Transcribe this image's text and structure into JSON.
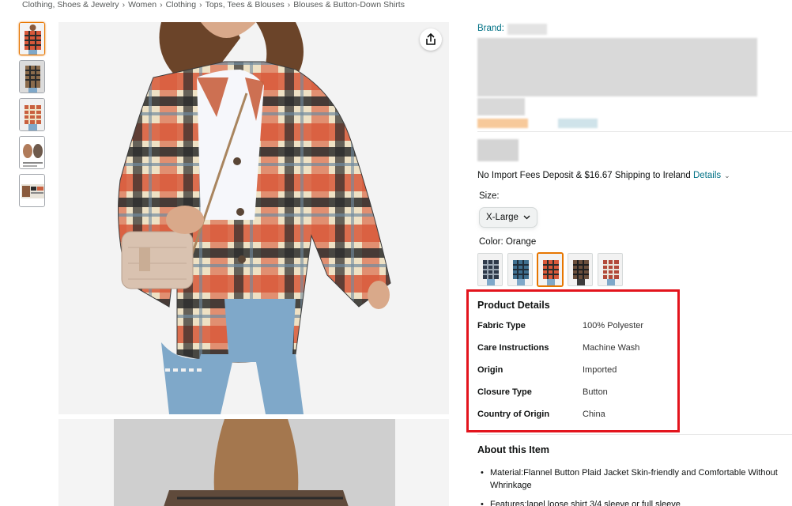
{
  "breadcrumb": [
    "Clothing, Shoes & Jewelry",
    "Women",
    "Clothing",
    "Tops, Tees & Blouses",
    "Blouses & Button-Down Shirts"
  ],
  "breadcrumb_separator": "›",
  "icons": {
    "share": "share-icon",
    "dropdown": "chevron-down-icon"
  },
  "product": {
    "brand_label": "Brand:",
    "shipping_text": "No Import Fees Deposit & $16.67 Shipping to Ireland",
    "shipping_link": "Details",
    "size_label": "Size:",
    "size_value": "X-Large",
    "color_label": "Color: Orange",
    "colors": {
      "accent_link": "#007185",
      "selected_outline": "#e77600",
      "highlight_box": "#e3141d",
      "plaid_orange": "#d8583a",
      "plaid_cream": "#eee1c4",
      "plaid_black": "#2b2b2b"
    }
  },
  "details": {
    "title": "Product Details",
    "rows": [
      {
        "key": "Fabric Type",
        "value": "100% Polyester"
      },
      {
        "key": "Care Instructions",
        "value": "Machine Wash"
      },
      {
        "key": "Origin",
        "value": "Imported"
      },
      {
        "key": "Closure Type",
        "value": "Button"
      },
      {
        "key": "Country of Origin",
        "value": "China"
      }
    ]
  },
  "about": {
    "title": "About this Item",
    "bullets": [
      "Material:Flannel Button Plaid Jacket Skin-friendly and Comfortable Without Whrinkage",
      "Features:lapel loose shirt 3/4 sleeve or full sleeve"
    ]
  }
}
